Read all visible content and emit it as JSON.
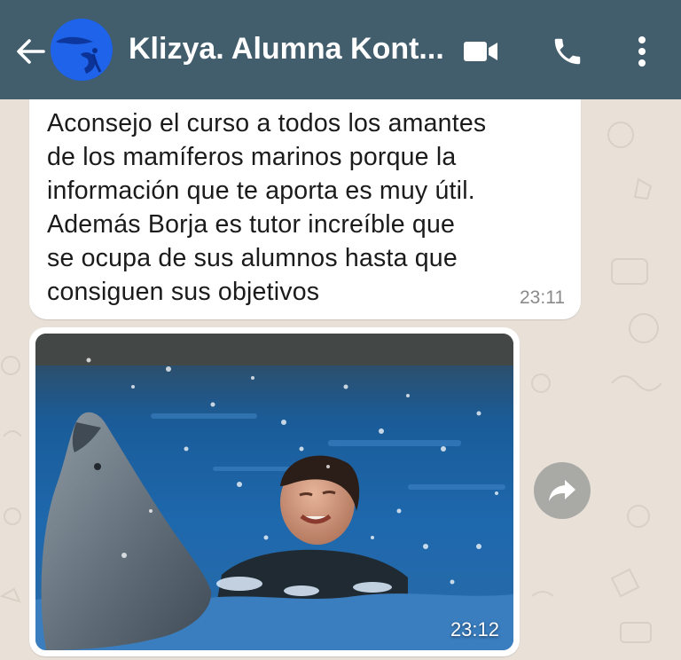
{
  "header": {
    "title": "Klizya. Alumna Kont...",
    "back_icon": "arrow-left-icon",
    "video_icon": "video-camera-icon",
    "call_icon": "phone-icon",
    "menu_icon": "more-vertical-icon",
    "color": "#425d6c"
  },
  "messages": [
    {
      "type": "text",
      "text": "Aconsejo el curso a todos los amantes\nde los mamíferos marinos porque la\ninformación que te aporta es muy útil.\nAdemás Borja es tutor increíble que\nse ocupa de sus alumnos hasta que\nconsiguen sus objetivos",
      "time": "23:11"
    },
    {
      "type": "image",
      "image_description_icon": "photo-dolphin-swimmer",
      "time": "23:12"
    }
  ],
  "forward_icon": "forward-arrow-icon",
  "colors": {
    "chat_background": "#e9e1d8",
    "bubble": "#ffffff",
    "forward_button": "#a9a9a6"
  }
}
